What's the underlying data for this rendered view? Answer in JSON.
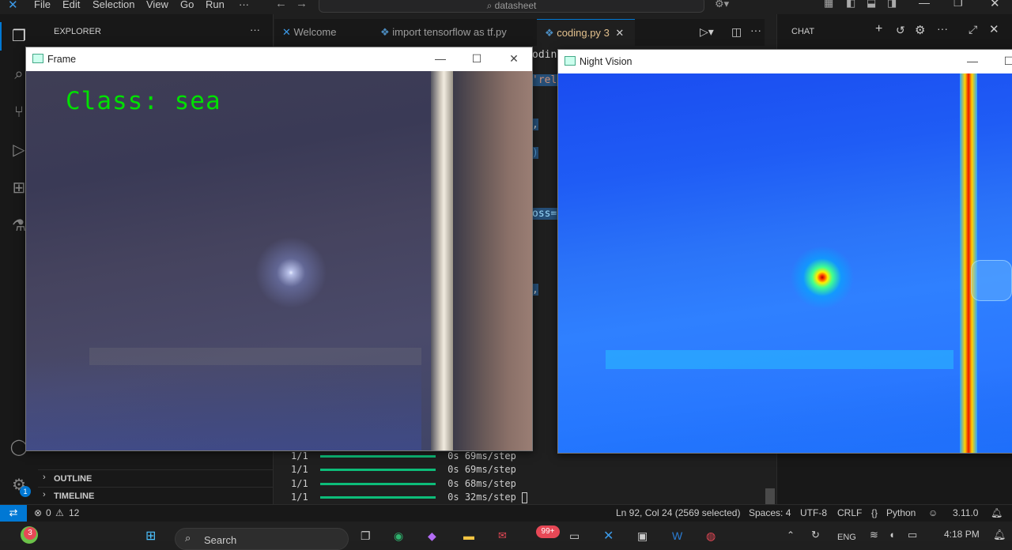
{
  "menu": [
    "File",
    "Edit",
    "Selection",
    "View",
    "Go",
    "Run",
    "···"
  ],
  "search": {
    "text": "datasheet"
  },
  "sidebar": {
    "title": "EXPLORER",
    "more": "···",
    "sections": [
      "OUTLINE",
      "TIMELINE"
    ]
  },
  "tabs": [
    {
      "label": "Welcome",
      "icon": "vscode-icon"
    },
    {
      "label": "import tensorflow as tf.py",
      "icon": "python-icon"
    },
    {
      "label": "coding.py",
      "badge": "3",
      "icon": "python-icon"
    }
  ],
  "editor_fragments": [
    "oding",
    "'relu",
    ",",
    ")",
    "oss='",
    ","
  ],
  "terminal": [
    {
      "steps": "1/1",
      "time": "0s 69ms/step"
    },
    {
      "steps": "1/1",
      "time": "0s 69ms/step"
    },
    {
      "steps": "1/1",
      "time": "0s 68ms/step"
    },
    {
      "steps": "1/1",
      "time": "0s 32ms/step"
    }
  ],
  "chat": {
    "title": "CHAT"
  },
  "frame_window": {
    "title": "Frame",
    "overlay_text": "Class: sea"
  },
  "night_window": {
    "title": "Night Vision"
  },
  "statusbar": {
    "errors": "0",
    "warnings": "12",
    "position": "Ln 92, Col 24 (2569 selected)",
    "spaces": "Spaces: 4",
    "encoding": "UTF-8",
    "eol": "CRLF",
    "language": "Python",
    "version": "3.11.0"
  },
  "taskbar": {
    "search": "Search",
    "badge_left": "3",
    "badge_mail": "99+",
    "lang": "ENG",
    "time": "4:18 PM"
  },
  "accounts_badge": "1",
  "colors": {
    "accent": "#0078d4",
    "overlay_green": "#00e000",
    "progress_green": "#0dbc79"
  }
}
